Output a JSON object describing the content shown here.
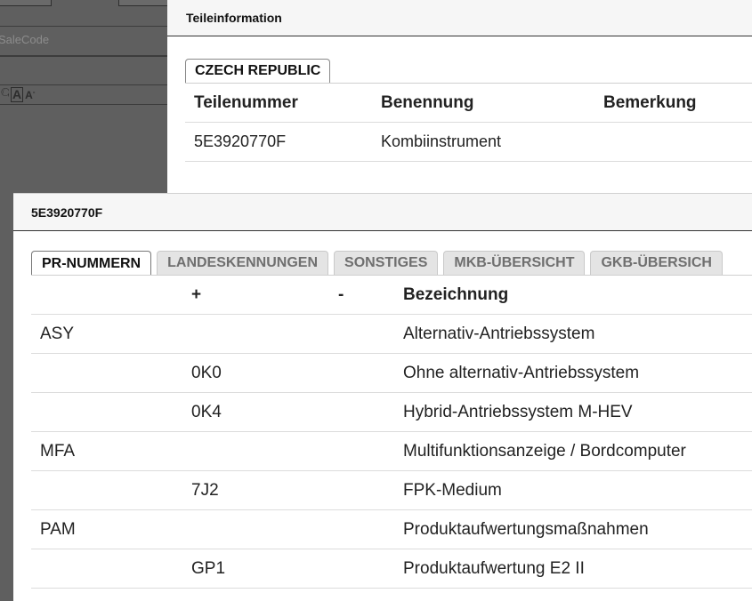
{
  "background": {
    "salecode_placeholder": "SaleCode",
    "font_large": "A",
    "font_small": "A"
  },
  "teileinfo": {
    "title": "Teileinformation",
    "country_tab": "CZECH REPUBLIC",
    "columns": [
      "Teilenummer",
      "Benennung",
      "Bemerkung"
    ],
    "rows": [
      [
        "5E3920770F",
        "Kombiinstrument",
        ""
      ]
    ]
  },
  "detail": {
    "title": "5E3920770F",
    "tabs": [
      "PR-NUMMERN",
      "LANDESKENNUNGEN",
      "SONSTIGES",
      "MKB-ÜBERSICHT",
      "GKB-ÜBERSICH"
    ],
    "active_tab": "PR-NUMMERN",
    "columns": [
      "",
      "+",
      "-",
      "Bezeichnung"
    ],
    "rows": [
      [
        "ASY",
        "",
        "",
        "Alternativ-Antriebssystem"
      ],
      [
        "",
        "0K0",
        "",
        "Ohne alternativ-Antriebssystem"
      ],
      [
        "",
        "0K4",
        "",
        "Hybrid-Antriebssystem M-HEV"
      ],
      [
        "MFA",
        "",
        "",
        "Multifunktionsanzeige / Bordcomputer"
      ],
      [
        "",
        "7J2",
        "",
        "FPK-Medium"
      ],
      [
        "PAM",
        "",
        "",
        "Produktaufwertungsmaßnahmen"
      ],
      [
        "",
        "GP1",
        "",
        "Produktaufwertung E2 II"
      ]
    ]
  }
}
